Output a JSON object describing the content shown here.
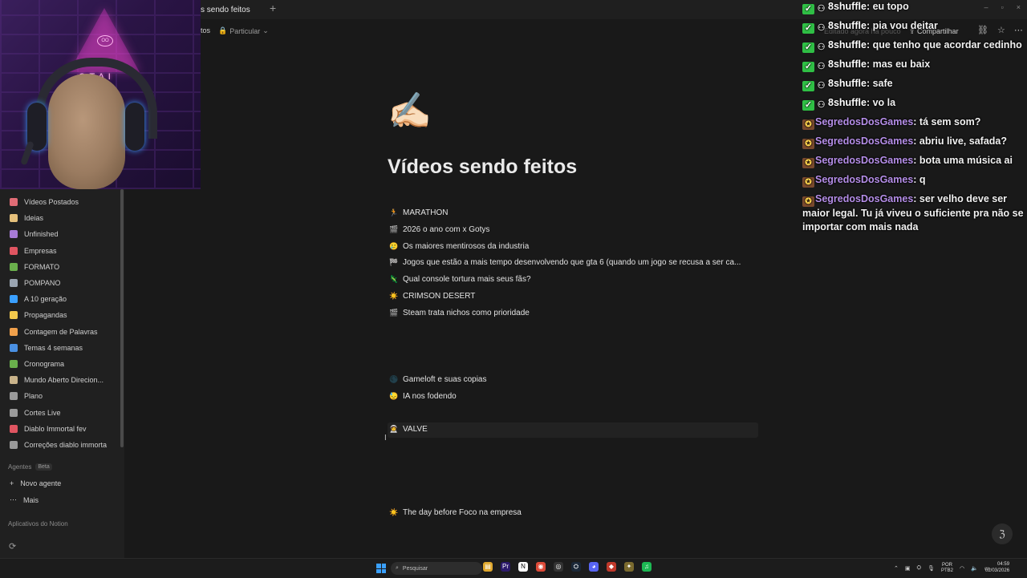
{
  "tab": {
    "title": "s sendo feitos",
    "new_tab": "+"
  },
  "window_controls": [
    "–",
    "▫",
    "×"
  ],
  "breadcrumb": {
    "title": "tos",
    "privacy": "Particular"
  },
  "topbar": {
    "edited": "Editado agora há pouco",
    "share_label": "Compartilhar"
  },
  "sidebar": {
    "items": [
      {
        "label": "Vídeos Postados",
        "color": "#e06c75",
        "icon": "book-icon"
      },
      {
        "label": "Ideias",
        "color": "#e5c07b",
        "icon": "bulb-icon"
      },
      {
        "label": "Unfinished",
        "color": "#a77bd6",
        "icon": "devil-icon"
      },
      {
        "label": "Empresas",
        "color": "#e05561",
        "icon": "circle-icon"
      },
      {
        "label": "FORMATO",
        "color": "#6ab04c",
        "icon": "clapper-icon"
      },
      {
        "label": "POMPANO",
        "color": "#9aa5b1",
        "icon": "pen-icon"
      },
      {
        "label": "A 10 geração",
        "color": "#3aa0ff",
        "icon": "ten-icon"
      },
      {
        "label": "Propagandas",
        "color": "#f2c94c",
        "icon": "face-icon"
      },
      {
        "label": "Contagem de Palavras",
        "color": "#f0a04b",
        "icon": "note-icon"
      },
      {
        "label": "Temas 4 semanas",
        "color": "#4a90e2",
        "icon": "calendar-icon"
      },
      {
        "label": "Cronograma",
        "color": "#6ab04c",
        "icon": "clapper-icon"
      },
      {
        "label": "Mundo Aberto Direcion...",
        "color": "#c9b38a",
        "icon": "figure-icon"
      },
      {
        "label": "Plano",
        "color": "#9a9a9a",
        "icon": "page-icon"
      },
      {
        "label": "Cortes Live",
        "color": "#9a9a9a",
        "icon": "page-icon"
      },
      {
        "label": "Diablo Immortal fev",
        "color": "#e05561",
        "icon": "devil-icon"
      },
      {
        "label": "Correções diablo immorta",
        "color": "#9a9a9a",
        "icon": "page-icon"
      }
    ],
    "agents_label": "Agentes",
    "beta_label": "Beta",
    "new_agent": "Novo agente",
    "more": "Mais",
    "apps_label": "Aplicativos do Notion"
  },
  "cam": {
    "neon_text": "OTAI",
    "neon_circle": "OO"
  },
  "page": {
    "icon": "✍🏻",
    "title": "Vídeos sendo feitos",
    "entries": [
      {
        "emoji": "🏃",
        "label": "MARATHON"
      },
      {
        "emoji": "🎬",
        "label": "2026 o ano com x Gotys"
      },
      {
        "emoji": "🥲",
        "label": "Os maiores mentirosos da industria"
      },
      {
        "emoji": "🏁",
        "label": "Jogos que estão a mais tempo desenvolvendo que gta 6 (quando um jogo se recusa a ser ca..."
      },
      {
        "emoji": "🦎",
        "label": "Qual console tortura mais seus fãs?"
      },
      {
        "emoji": "☀️",
        "label": "CRIMSON DESERT"
      },
      {
        "emoji": "🎬",
        "label": "Steam trata nichos como prioridade"
      },
      {
        "emoji": "🌑",
        "label": "Gameloft e suas copias"
      },
      {
        "emoji": "😓",
        "label": "IA nos fodendo"
      },
      {
        "emoji": "🧑‍🚀",
        "label": "VALVE"
      },
      {
        "emoji": "☀️",
        "label": "The day before Foco na empresa"
      }
    ]
  },
  "chat": [
    {
      "badges": [
        "check",
        "gray"
      ],
      "user": "8shuffle",
      "text": "eu topo"
    },
    {
      "badges": [
        "check",
        "gray"
      ],
      "user": "8shuffle",
      "text": "pia vou deitar"
    },
    {
      "badges": [
        "check",
        "gray"
      ],
      "user": "8shuffle",
      "text": "que tenho que acordar cedinho"
    },
    {
      "badges": [
        "check",
        "gray"
      ],
      "user": "8shuffle",
      "text": "mas eu baix"
    },
    {
      "badges": [
        "check",
        "gray"
      ],
      "user": "8shuffle",
      "text": "safe"
    },
    {
      "badges": [
        "check",
        "gray"
      ],
      "user": "8shuffle",
      "text": "vo la"
    },
    {
      "badges": [
        "sg"
      ],
      "user": "SegredosDosGames",
      "text": "tá sem som?"
    },
    {
      "badges": [
        "sg"
      ],
      "user": "SegredosDosGames",
      "text": "abriu live, safada?"
    },
    {
      "badges": [
        "sg"
      ],
      "user": "SegredosDosGames",
      "text": "bota uma música ai"
    },
    {
      "badges": [
        "sg"
      ],
      "user": "SegredosDosGames",
      "text": "q"
    },
    {
      "badges": [
        "sg"
      ],
      "user": "SegredosDosGames",
      "text": "ser velho deve ser maior legal. Tu já viveu o suficiente pra não se importar com mais nada"
    }
  ],
  "taskbar": {
    "search_placeholder": "Pesquisar",
    "lang_top": "POR",
    "lang_bottom": "PTB2",
    "time": "04:59",
    "date": "02/03/2026"
  },
  "colors": {
    "background": "#191919",
    "sidebar": "#202020",
    "twitch_purple": "#b58ee8"
  }
}
